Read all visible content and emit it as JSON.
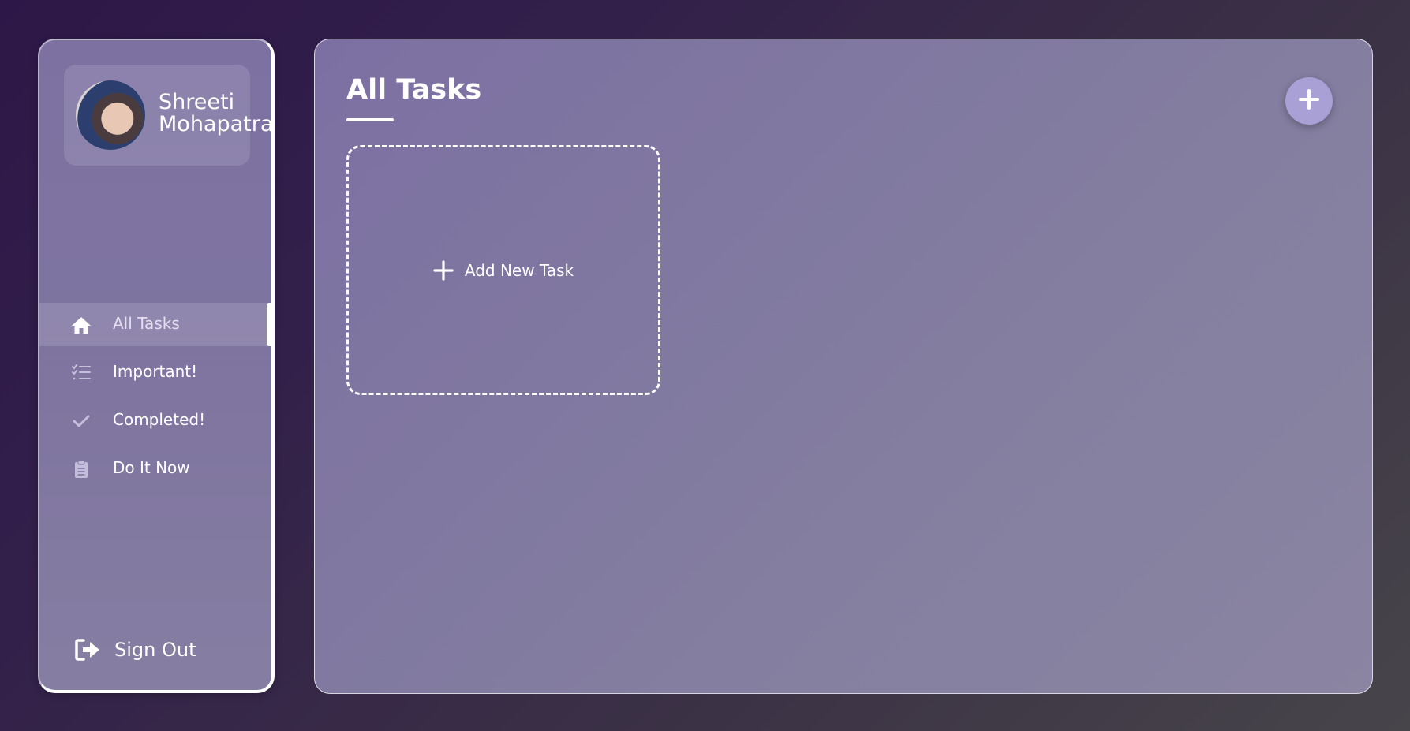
{
  "profile": {
    "first_name": "Shreeti",
    "last_name": "Mohapatra"
  },
  "nav": {
    "items": [
      {
        "label": "All Tasks",
        "icon": "home-icon",
        "active": true
      },
      {
        "label": "Important!",
        "icon": "list-check-icon",
        "active": false
      },
      {
        "label": "Completed!",
        "icon": "check-icon",
        "active": false
      },
      {
        "label": "Do It Now",
        "icon": "clipboard-icon",
        "active": false
      }
    ]
  },
  "signout": {
    "label": "Sign Out",
    "icon": "sign-out-icon"
  },
  "main": {
    "title": "All Tasks",
    "add_card_label": "Add New Task",
    "fab_icon": "plus-icon"
  },
  "colors": {
    "accent": "#a9a0d6",
    "panel": "#7f75a0",
    "text": "#ffffff"
  }
}
